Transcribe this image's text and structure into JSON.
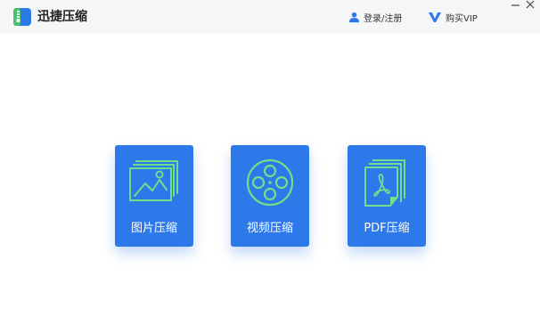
{
  "app": {
    "title": "迅捷压缩",
    "logo_icon": "zip-file-icon"
  },
  "header": {
    "login_label": "登录/注册",
    "login_icon": "user-icon",
    "vip_label": "购买VIP",
    "vip_icon": "vip-icon"
  },
  "window_controls": {
    "minimize": "minimize-icon",
    "close": "close-icon"
  },
  "cards": [
    {
      "label": "图片压缩",
      "icon": "image-stack-icon"
    },
    {
      "label": "视频压缩",
      "icon": "film-reel-icon"
    },
    {
      "label": "PDF压缩",
      "icon": "pdf-document-icon"
    }
  ],
  "colors": {
    "card_background": "#2d79ea",
    "icon_accent": "#6de08a",
    "header_background": "#f5f6f8",
    "logo_blue": "#2c7be5"
  }
}
